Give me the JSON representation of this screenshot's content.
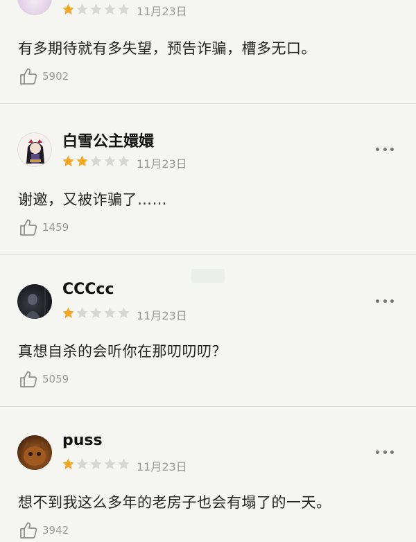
{
  "colors": {
    "background": "#f5f6f2",
    "star_filled": "#f4a623",
    "star_empty": "#d6d7d3",
    "muted_text": "#9a9b97"
  },
  "reviews": [
    {
      "username": "",
      "stars": 1,
      "date": "11月23日",
      "content": "有多期待就有多失望，预告诈骗，槽多无口。",
      "likes": "5902"
    },
    {
      "username": "白雪公主嬛嬛",
      "stars": 2,
      "date": "11月23日",
      "content": "谢邀，又被诈骗了……",
      "likes": "1459"
    },
    {
      "username": "CCCcc",
      "stars": 1,
      "date": "11月23日",
      "content": "真想自杀的会听你在那叨叨叨？",
      "likes": "5059"
    },
    {
      "username": "puss",
      "stars": 1,
      "date": "11月23日",
      "content": "想不到我这么多年的老房子也会有塌了的一天。",
      "likes": "3942"
    }
  ]
}
